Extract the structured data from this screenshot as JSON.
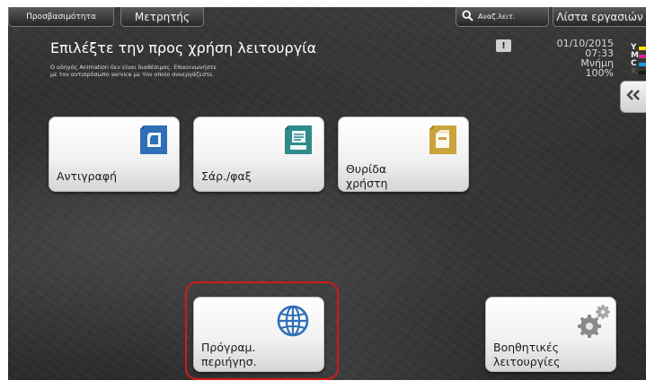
{
  "tabs": {
    "accessibility_label": "Προσβασιμότητα",
    "counter_label": "Μετρητής",
    "search_label": "Αναζ.λειτ.",
    "job_list_label": "Λίστα εργασιών"
  },
  "header": {
    "title": "Επιλέξτε την προς χρήση λειτουργία",
    "message_line1": "Ο οδηγός Animation δεν είναι διαθέσιμος. Επικοινωνήστε",
    "message_line2": "με τον αντιπρόσωπο service με τον οποίο συνεργάζεστε."
  },
  "status": {
    "date": "01/10/2015",
    "time": "07:33",
    "memory_label": "Μνήμη",
    "memory_value": "100%"
  },
  "toner": [
    {
      "letter": "Y",
      "color": "#f2e600"
    },
    {
      "letter": "M",
      "color": "#e0208c"
    },
    {
      "letter": "C",
      "color": "#1a9ee0"
    },
    {
      "letter": "K",
      "color": "#1a1a1a"
    }
  ],
  "functions": {
    "copy": "Αντιγραφή",
    "scan_fax": "Σάρ./φαξ",
    "user_box_line1": "Θυρίδα",
    "user_box_line2": "χρήστη",
    "web_browser_line1": "Πρόγραμ.",
    "web_browser_line2": "περιήγησ.",
    "utility_line1": "Βοηθητικές",
    "utility_line2": "λειτουργίες"
  },
  "colors": {
    "icon_blue": "#2f6fb8",
    "icon_teal": "#2f8a8a",
    "icon_gold": "#c9a43a",
    "highlight_red": "#d11a1a"
  },
  "icons": {
    "copy": "copy-icon",
    "scan": "scan-fax-icon",
    "box": "user-box-icon",
    "web": "globe-icon",
    "utility": "gears-icon",
    "search": "magnifier-icon",
    "alert": "alert-icon",
    "collapse": "double-chevron-left-icon"
  }
}
